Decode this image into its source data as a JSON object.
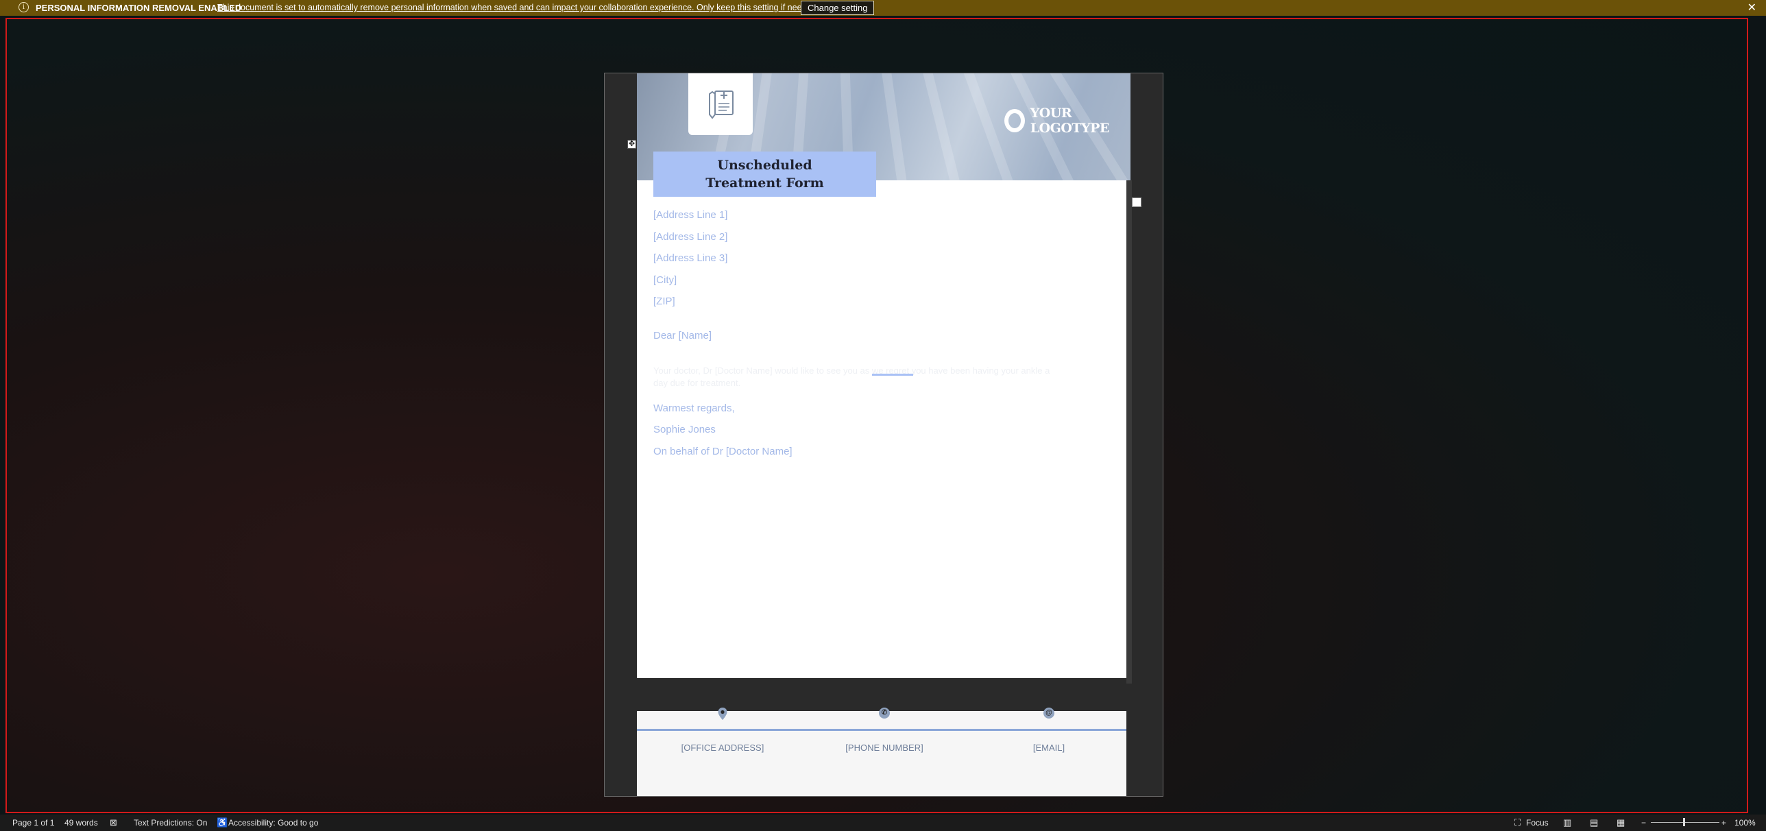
{
  "notification": {
    "title": "PERSONAL INFORMATION REMOVAL ENABLED",
    "message": "This document is set to automatically remove personal information when saved and can impact your collaboration experience. Only keep this setting if needed.",
    "button": "Change setting",
    "close": "✕"
  },
  "document": {
    "logotype": "YOUR LOGOTYPE",
    "title_line1": "Unscheduled",
    "title_line2": "Treatment Form",
    "address": [
      "[Address Line 1]",
      "[Address Line 2]",
      "[Address Line 3]",
      "[City]",
      "[ZIP]"
    ],
    "greeting": "Dear [Name]",
    "body_line1": "Your doctor, Dr [Doctor Name] would like to see you as we regret you have been having your ankle a",
    "body_line2": "day due for treatment.",
    "closing": "Warmest regards,",
    "signature": "Sophie Jones",
    "behalf": "On behalf of Dr [Doctor Name]",
    "footer": {
      "office": "[OFFICE ADDRESS]",
      "phone": "[PHONE NUMBER]",
      "email": "[EMAIL]"
    }
  },
  "status_bar": {
    "page": "Page 1 of 1",
    "words": "49 words",
    "predictions": "Text Predictions: On",
    "accessibility": "Accessibility: Good to go",
    "focus": "Focus",
    "zoom_minus": "−",
    "zoom_plus": "+",
    "zoom": "100%"
  },
  "zoom_level_percent": 100
}
